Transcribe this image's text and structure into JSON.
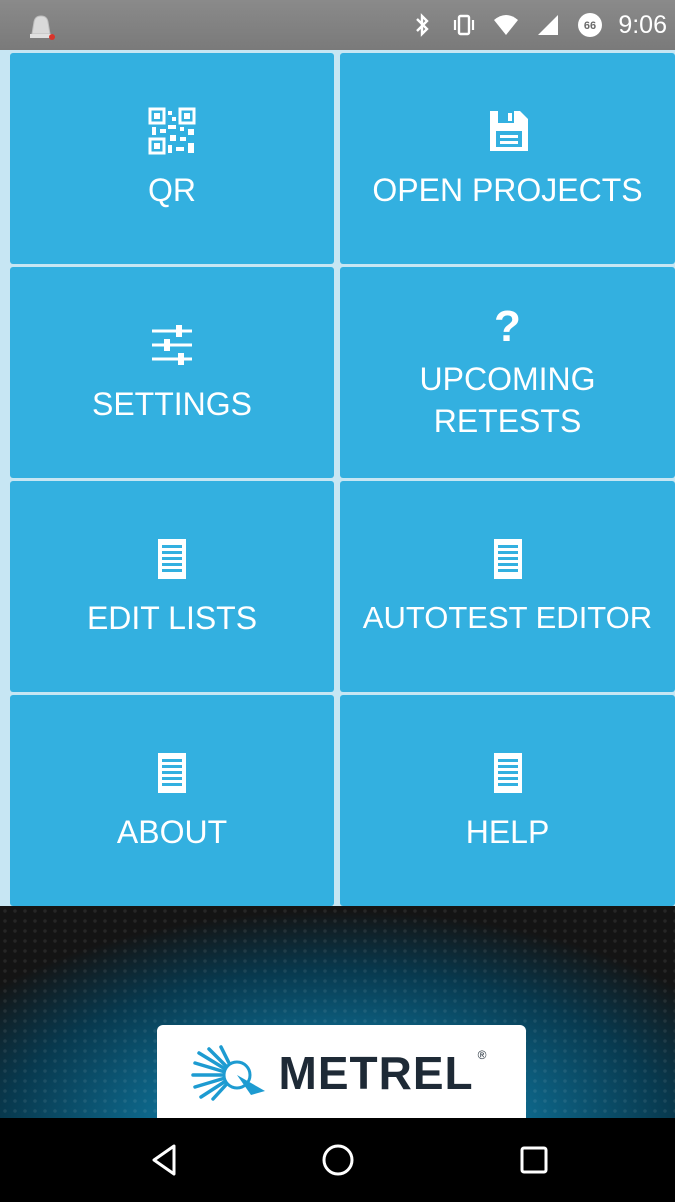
{
  "status_bar": {
    "time": "9:06",
    "icons": [
      "notification-bell-icon",
      "bluetooth-icon",
      "vibrate-icon",
      "wifi-icon",
      "cell-signal-icon",
      "battery-66-icon"
    ],
    "battery_level": "66"
  },
  "tiles": [
    {
      "label": "QR",
      "icon": "qr-code-icon"
    },
    {
      "label": "OPEN PROJECTS",
      "icon": "save-icon"
    },
    {
      "label": "SETTINGS",
      "icon": "sliders-icon"
    },
    {
      "label": "UPCOMING RETESTS",
      "icon": "question-icon",
      "icon_glyph": "?"
    },
    {
      "label": "EDIT LISTS",
      "icon": "document-icon"
    },
    {
      "label": "AUTOTEST EDITOR",
      "icon": "document-icon"
    },
    {
      "label": "ABOUT",
      "icon": "document-icon"
    },
    {
      "label": "HELP",
      "icon": "document-icon"
    }
  ],
  "brand": {
    "logo_text": "METREL",
    "registered_mark": "®"
  },
  "navigation": {
    "buttons": [
      "back-icon",
      "home-icon",
      "recents-icon"
    ]
  },
  "colors": {
    "tile_bg": "#33b0e0",
    "grid_gap": "#c7e6f3",
    "status_bar": "#808080",
    "nav_bar": "#000000"
  }
}
